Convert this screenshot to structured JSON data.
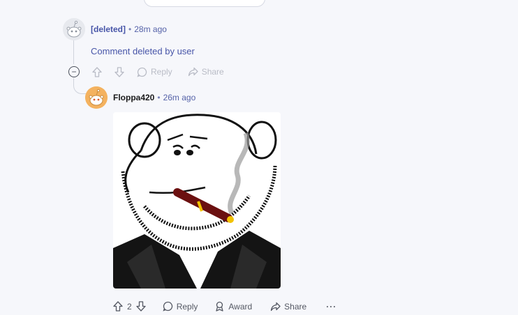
{
  "comment1": {
    "author": "[deleted]",
    "age": "28m ago",
    "body": "Comment deleted by user",
    "reply_label": "Reply",
    "share_label": "Share",
    "collapse_symbol": "−"
  },
  "comment2": {
    "author": "Floppa420",
    "age": "26m ago",
    "votes": "2",
    "reply_label": "Reply",
    "award_label": "Award",
    "share_label": "Share",
    "more_symbol": "···"
  },
  "colors": {
    "author_deleted": "#4755a8",
    "link_meta": "#5562a8",
    "action_inactive": "#b9bcc6",
    "action_active": "#545863"
  },
  "icons": [
    "upvote-icon",
    "downvote-icon",
    "reply-icon",
    "share-icon",
    "award-icon",
    "collapse-icon",
    "more-icon"
  ]
}
